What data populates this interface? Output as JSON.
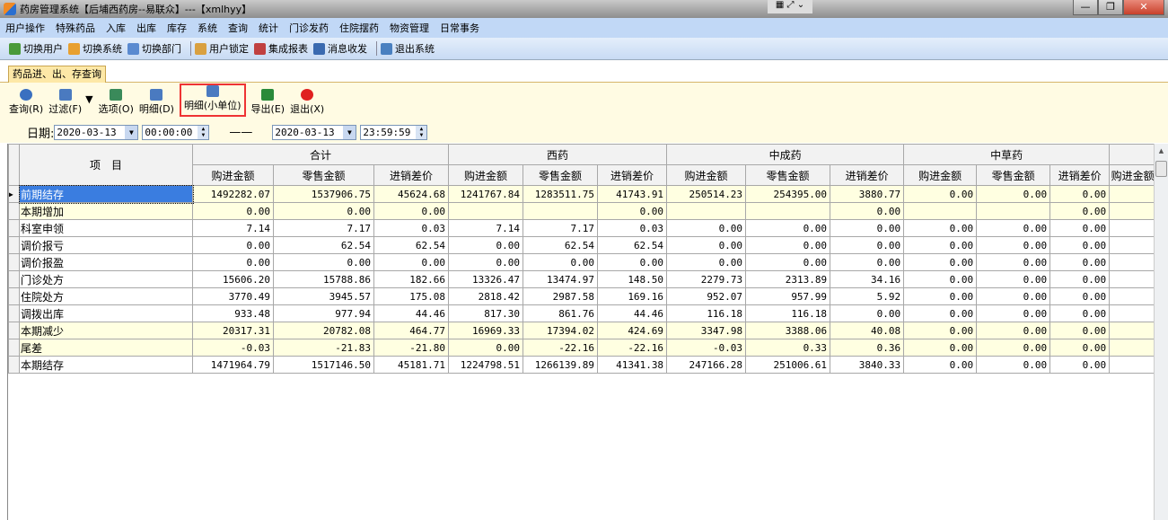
{
  "window": {
    "title": "药房管理系统【后埔西药房--易联众】---【xmlhyy】",
    "controls": [
      "—",
      "❐",
      "✕"
    ]
  },
  "menu": [
    "用户操作",
    "特殊药品",
    "入库",
    "出库",
    "库存",
    "系统",
    "查询",
    "统计",
    "门诊发药",
    "住院摆药",
    "物资管理",
    "日常事务"
  ],
  "toolbar": [
    {
      "label": "切换用户",
      "icon": "users-icon",
      "color": "#4a9a3a"
    },
    {
      "label": "切换系统",
      "icon": "switch-system-icon",
      "color": "#e8a030"
    },
    {
      "label": "切换部门",
      "icon": "department-icon",
      "color": "#5a8ad0"
    },
    {
      "label": "用户锁定",
      "icon": "user-lock-icon",
      "color": "#d9a040"
    },
    {
      "label": "集成报表",
      "icon": "report-icon",
      "color": "#c04040"
    },
    {
      "label": "消息收发",
      "icon": "info-icon",
      "color": "#3a6ab0"
    },
    {
      "label": "退出系统",
      "icon": "exit-system-icon",
      "color": "#4a80c0"
    }
  ],
  "tab": {
    "label": "药品进、出、存查询"
  },
  "actions": [
    {
      "label": "查询(R)",
      "icon": "refresh-icon",
      "color": "#3a70c0"
    },
    {
      "label": "过滤(F)",
      "icon": "filter-icon",
      "color": "#4a7ac0"
    },
    {
      "label": "▼",
      "icon": "dropdown-icon",
      "color": "#000"
    },
    {
      "label": "选项(O)",
      "icon": "options-icon",
      "color": "#3a8a5a"
    },
    {
      "label": "明细(D)",
      "icon": "detail-icon",
      "color": "#4a7ac0"
    },
    {
      "label": "明细(小单位)",
      "icon": "detail-small-unit-icon",
      "color": "#4a7ac0"
    },
    {
      "label": "导出(E)",
      "icon": "excel-icon",
      "color": "#2a8a3a"
    },
    {
      "label": "退出(X)",
      "icon": "power-icon",
      "color": "#e02020"
    }
  ],
  "date": {
    "label": "日期:",
    "start_date": "2020-03-13",
    "start_time": "00:00:00",
    "separator": "——",
    "end_date": "2020-03-13",
    "end_time": "23:59:59"
  },
  "table": {
    "item_header": "项　目",
    "groups": [
      "合计",
      "西药",
      "中成药",
      "中草药",
      ""
    ],
    "sub_headers": [
      "购进金额",
      "零售金额",
      "进销差价",
      "购进金额",
      "零售金额",
      "进销差价",
      "购进金额",
      "零售金额",
      "进销差价",
      "购进金额",
      "零售金额",
      "进销差价",
      "购进金额"
    ],
    "rows": [
      {
        "label": "前期结存",
        "highlight": true,
        "values": [
          "1492282.07",
          "1537906.75",
          "45624.68",
          "1241767.84",
          "1283511.75",
          "41743.91",
          "250514.23",
          "254395.00",
          "3880.77",
          "0.00",
          "0.00",
          "0.00",
          ""
        ]
      },
      {
        "label": "本期增加",
        "highlight": true,
        "values": [
          "0.00",
          "0.00",
          "0.00",
          "",
          "",
          "0.00",
          "",
          "",
          "0.00",
          "",
          "",
          "0.00",
          ""
        ]
      },
      {
        "label": "科室申领",
        "highlight": false,
        "values": [
          "7.14",
          "7.17",
          "0.03",
          "7.14",
          "7.17",
          "0.03",
          "0.00",
          "0.00",
          "0.00",
          "0.00",
          "0.00",
          "0.00",
          ""
        ]
      },
      {
        "label": "调价报亏",
        "highlight": false,
        "values": [
          "0.00",
          "62.54",
          "62.54",
          "0.00",
          "62.54",
          "62.54",
          "0.00",
          "0.00",
          "0.00",
          "0.00",
          "0.00",
          "0.00",
          ""
        ]
      },
      {
        "label": "调价报盈",
        "highlight": false,
        "values": [
          "0.00",
          "0.00",
          "0.00",
          "0.00",
          "0.00",
          "0.00",
          "0.00",
          "0.00",
          "0.00",
          "0.00",
          "0.00",
          "0.00",
          ""
        ]
      },
      {
        "label": "门诊处方",
        "highlight": false,
        "values": [
          "15606.20",
          "15788.86",
          "182.66",
          "13326.47",
          "13474.97",
          "148.50",
          "2279.73",
          "2313.89",
          "34.16",
          "0.00",
          "0.00",
          "0.00",
          ""
        ]
      },
      {
        "label": "住院处方",
        "highlight": false,
        "values": [
          "3770.49",
          "3945.57",
          "175.08",
          "2818.42",
          "2987.58",
          "169.16",
          "952.07",
          "957.99",
          "5.92",
          "0.00",
          "0.00",
          "0.00",
          ""
        ]
      },
      {
        "label": "调拨出库",
        "highlight": false,
        "values": [
          "933.48",
          "977.94",
          "44.46",
          "817.30",
          "861.76",
          "44.46",
          "116.18",
          "116.18",
          "0.00",
          "0.00",
          "0.00",
          "0.00",
          ""
        ]
      },
      {
        "label": "本期减少",
        "highlight": true,
        "values": [
          "20317.31",
          "20782.08",
          "464.77",
          "16969.33",
          "17394.02",
          "424.69",
          "3347.98",
          "3388.06",
          "40.08",
          "0.00",
          "0.00",
          "0.00",
          ""
        ]
      },
      {
        "label": "尾差",
        "highlight": true,
        "values": [
          "-0.03",
          "-21.83",
          "-21.80",
          "0.00",
          "-22.16",
          "-22.16",
          "-0.03",
          "0.33",
          "0.36",
          "0.00",
          "0.00",
          "0.00",
          ""
        ]
      },
      {
        "label": "本期结存",
        "highlight": false,
        "values": [
          "1471964.79",
          "1517146.50",
          "45181.71",
          "1224798.51",
          "1266139.89",
          "41341.38",
          "247166.28",
          "251006.61",
          "3840.33",
          "0.00",
          "0.00",
          "0.00",
          ""
        ]
      }
    ]
  }
}
